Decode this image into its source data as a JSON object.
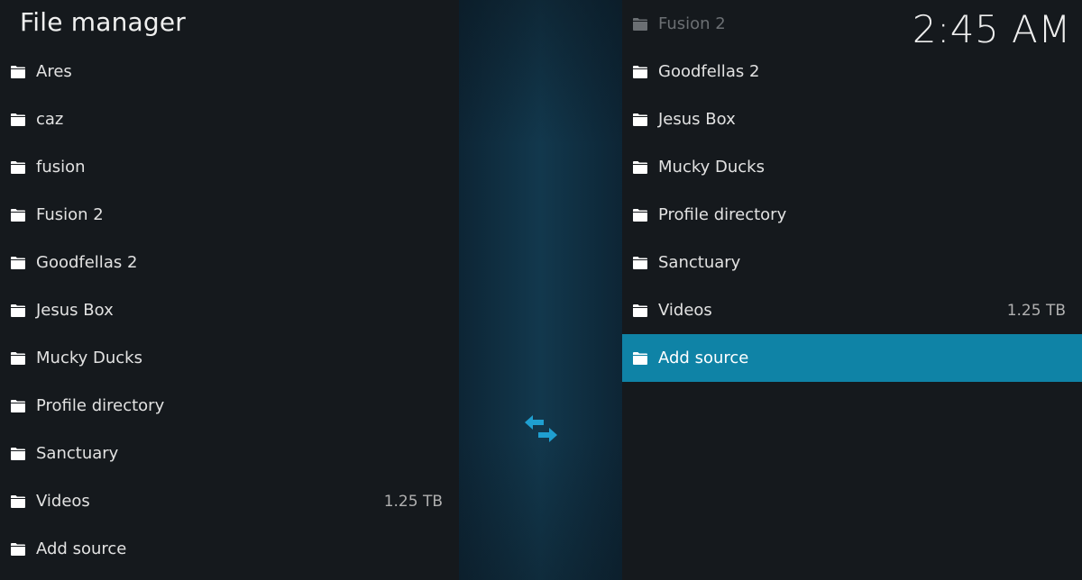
{
  "window": {
    "title": "File manager",
    "clock": "2:45 AM"
  },
  "left_pane": {
    "items": [
      {
        "label": "Ares",
        "size": ""
      },
      {
        "label": "caz",
        "size": ""
      },
      {
        "label": "fusion",
        "size": ""
      },
      {
        "label": "Fusion 2",
        "size": ""
      },
      {
        "label": "Goodfellas 2",
        "size": ""
      },
      {
        "label": "Jesus Box",
        "size": ""
      },
      {
        "label": "Mucky Ducks",
        "size": ""
      },
      {
        "label": "Profile directory",
        "size": ""
      },
      {
        "label": "Sanctuary",
        "size": ""
      },
      {
        "label": "Videos",
        "size": "1.25 TB"
      },
      {
        "label": "Add source",
        "size": ""
      }
    ]
  },
  "right_pane": {
    "items": [
      {
        "label": "Fusion 2",
        "size": ""
      },
      {
        "label": "Goodfellas 2",
        "size": ""
      },
      {
        "label": "Jesus Box",
        "size": ""
      },
      {
        "label": "Mucky Ducks",
        "size": ""
      },
      {
        "label": "Profile directory",
        "size": ""
      },
      {
        "label": "Sanctuary",
        "size": ""
      },
      {
        "label": "Videos",
        "size": "1.25 TB"
      },
      {
        "label": "Add source",
        "size": ""
      }
    ],
    "selected_index": 7
  },
  "icons": {
    "folder": "folder-icon",
    "swap": "swap-panes-icon"
  },
  "colors": {
    "background": "#15191d",
    "accent": "#0f83a6",
    "swap_icon": "#1f9fd0"
  }
}
